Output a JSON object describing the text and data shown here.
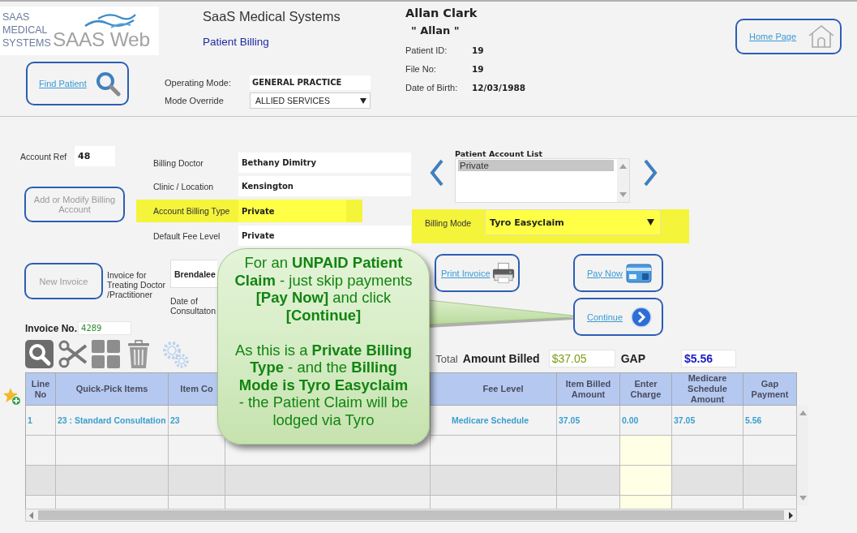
{
  "logo": {
    "lines": [
      "SAAS",
      "MEDICAL",
      "SYSTEMS"
    ],
    "product": "SAAS Web"
  },
  "header": {
    "company": "SaaS Medical Systems",
    "page_title": "Patient Billing",
    "find_button": {
      "label": "Find Patient"
    },
    "operating_mode": {
      "label": "Operating Mode:",
      "value": "GENERAL PRACTICE"
    },
    "mode_override": {
      "label": "Mode Override",
      "value": "ALLIED SERVICES"
    },
    "home_button": {
      "label": "Home Page"
    }
  },
  "patient": {
    "name": "Allan Clark",
    "preferred_name": "\" Allan \"",
    "details": [
      {
        "label": "Patient ID:",
        "value": "19"
      },
      {
        "label": "File No:",
        "value": "19"
      },
      {
        "label": "Date of Birth:",
        "value": "12/03/1988"
      }
    ]
  },
  "account": {
    "ref_label": "Account Ref",
    "ref_value": "48",
    "modify_button": {
      "label": "Add or Modify Billing Account",
      "disabled": true
    }
  },
  "billing_fields": [
    {
      "label": "Billing Doctor",
      "value": "Bethany Dimitry",
      "highlighted": false
    },
    {
      "label": "Clinic / Location",
      "value": "Kensington",
      "highlighted": false
    },
    {
      "label": "Account Billing Type",
      "value": "Private",
      "highlighted": true
    },
    {
      "label": "Default Fee Level",
      "value": "Private",
      "highlighted": false
    }
  ],
  "account_list": {
    "label": "Patient Account List",
    "items": [
      {
        "label": "Private",
        "selected": true
      }
    ]
  },
  "billing_mode": {
    "label": "Billing Mode",
    "value": "Tyro Easyclaim",
    "highlighted": true
  },
  "invoice": {
    "new_button": {
      "label": "New Invoice",
      "disabled": true
    },
    "doctor_label": "Invoice for Treating Doctor /Practitioner",
    "doctor_value": "Brendalee",
    "date_label": "Date of Consultaton",
    "number_label": "Invoice No.",
    "number_value": "4289"
  },
  "invoice_actions": {
    "print_button": {
      "label": "Print Invoice"
    },
    "pay_button": {
      "label": "Pay Now"
    },
    "continue_button": {
      "label": "Continue"
    }
  },
  "totals": {
    "total_label": "Total",
    "amount_label": "Amount Billed",
    "amount_value": "$37.05",
    "gap_label": "GAP",
    "gap_value": "$5.56"
  },
  "table": {
    "columns": [
      {
        "label": "Line No",
        "editable": false
      },
      {
        "label": "Quick-Pick Items",
        "editable": false
      },
      {
        "label": "Item Co",
        "editable": false
      },
      {
        "editable": false
      },
      {
        "label": "Fee Level",
        "editable": false
      },
      {
        "label": "Item Billed Amount",
        "editable": false
      },
      {
        "label": "Enter Charge",
        "editable": true
      },
      {
        "label": "Medicare Schedule Amount",
        "editable": false
      },
      {
        "label": "Gap Payment",
        "editable": false
      }
    ],
    "rows": [
      {
        "cells": [
          "1",
          "23 : Standard Consultation",
          "23",
          null,
          "Medicare Schedule",
          "37.05",
          "0.00",
          "37.05",
          "5.56"
        ]
      }
    ]
  },
  "callout": {
    "paragraphs": [
      [
        "For an **UNPAID Patient**",
        "**Claim** - just skip payments",
        "**[Pay Now]** and click",
        "**[Continue]**"
      ],
      [
        "As this is a **Private Billing**",
        "**Type** - and the **Billing**",
        "**Mode is Tyro Easyclaim**",
        "- the Patient Claim will be",
        "lodged via Tyro"
      ]
    ]
  }
}
